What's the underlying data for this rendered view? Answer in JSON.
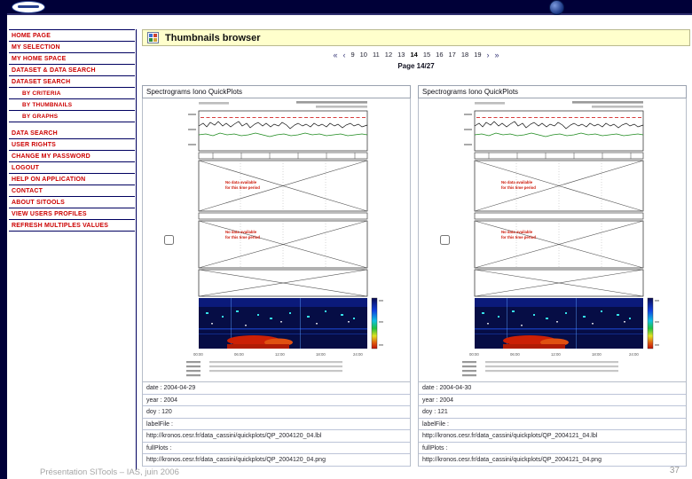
{
  "footer": {
    "caption": "Présentation SITools – IAS, juin 2006",
    "page_number": "37"
  },
  "sidebar": {
    "items": [
      {
        "label": "HOME PAGE"
      },
      {
        "label": "MY SELECTION"
      },
      {
        "label": "MY HOME SPACE"
      },
      {
        "label": "DATASET & DATA SEARCH"
      },
      {
        "label": "DATASET SEARCH"
      },
      {
        "label": "BY CRITERIA"
      },
      {
        "label": "BY THUMBNAILS"
      },
      {
        "label": "BY GRAPHS"
      },
      {
        "label": "DATA SEARCH"
      },
      {
        "label": "USER RIGHTS"
      },
      {
        "label": "CHANGE MY PASSWORD"
      },
      {
        "label": "LOGOUT"
      },
      {
        "label": "HELP ON APPLICATION"
      },
      {
        "label": "CONTACT"
      },
      {
        "label": "ABOUT SITOOLS"
      },
      {
        "label": "VIEW USERS PROFILES"
      },
      {
        "label": "REFRESH MULTIPLES VALUES"
      }
    ]
  },
  "main": {
    "title": "Thumbnails browser",
    "pagination": {
      "first": "«",
      "prev": "‹",
      "next": "›",
      "last": "»",
      "pages": [
        "9",
        "10",
        "11",
        "12",
        "13",
        "14",
        "15",
        "16",
        "17",
        "18",
        "19"
      ],
      "current_page": "14",
      "page_label": "Page 14/27"
    },
    "plot": {
      "note_line1": "No data available",
      "note_line2": "for this time period",
      "x_ticks": [
        "00:00",
        "06:00",
        "12:00",
        "18:00",
        "24:00"
      ]
    },
    "thumbnails": [
      {
        "title": "Spectrograms Iono QuickPlots",
        "rows": [
          "date : 2004-04-29",
          "year : 2004",
          "doy : 120",
          "labelFile :",
          "http://kronos.cesr.fr/data_cassini/quickplots/QP_2004120_04.lbl",
          "fullPlots :",
          "http://kronos.cesr.fr/data_cassini/quickplots/QP_2004120_04.png"
        ]
      },
      {
        "title": "Spectrograms Iono QuickPlots",
        "rows": [
          "date : 2004-04-30",
          "year : 2004",
          "doy : 121",
          "labelFile :",
          "http://kronos.cesr.fr/data_cassini/quickplots/QP_2004121_04.lbl",
          "fullPlots :",
          "http://kronos.cesr.fr/data_cassini/quickplots/QP_2004121_04.png"
        ]
      }
    ]
  },
  "colors": {
    "menu_red": "#cc0000",
    "navy": "#000038",
    "title_bg": "#ffffcc"
  }
}
